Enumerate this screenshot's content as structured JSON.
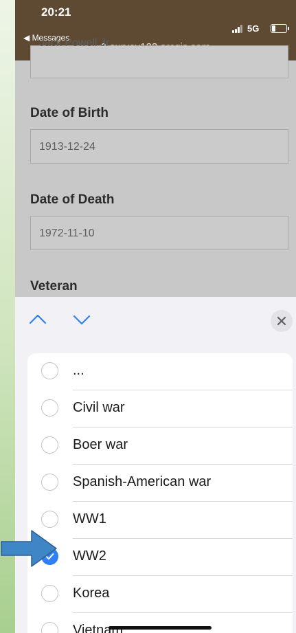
{
  "status_bar": {
    "time": "20:21",
    "back_app": "◀ Messages",
    "url": "survey123.arcgis.com",
    "network": "5G",
    "background_color": "#5e4a33"
  },
  "form": {
    "partial_field_value": "Jack Powell Jr",
    "date_of_birth": {
      "label": "Date of Birth",
      "value": "1913-12-24"
    },
    "date_of_death": {
      "label": "Date of Death",
      "value": "1972-11-10"
    },
    "veteran_label": "Veteran"
  },
  "picker": {
    "nav_up_icon": "chevron-up-icon",
    "nav_down_icon": "chevron-down-icon",
    "close_icon": "close-icon",
    "accent_color": "#2f80f7",
    "options": [
      {
        "label": "...",
        "checked": false
      },
      {
        "label": "Civil war",
        "checked": false
      },
      {
        "label": "Boer war",
        "checked": false
      },
      {
        "label": "Spanish-American war",
        "checked": false
      },
      {
        "label": "WW1",
        "checked": false
      },
      {
        "label": "WW2",
        "checked": true
      },
      {
        "label": "Korea",
        "checked": false
      },
      {
        "label": "Vietnam",
        "checked": false
      }
    ]
  },
  "annotation": {
    "icon": "arrow-right-icon",
    "color": "#3f86c7"
  }
}
